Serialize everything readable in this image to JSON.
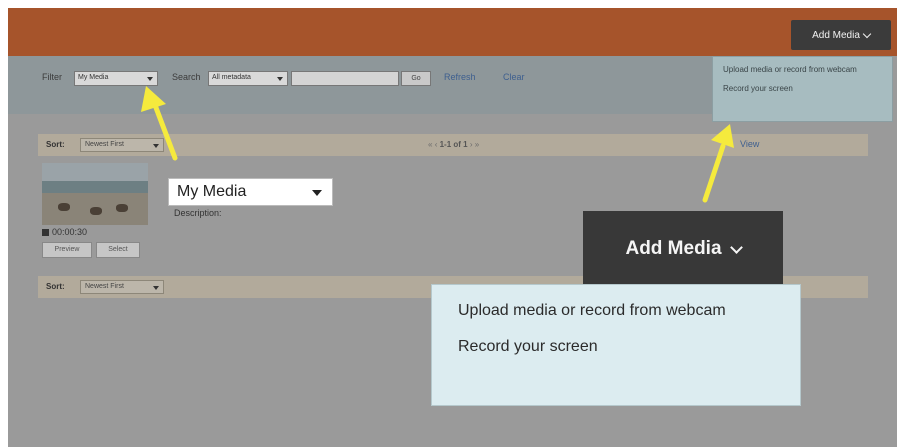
{
  "header": {
    "add_media_label": "Add Media"
  },
  "add_media_menu": {
    "items": [
      "Upload media or record from webcam",
      "Record your screen"
    ]
  },
  "filter_bar": {
    "filter_label": "Filter",
    "filter_value": "My Media",
    "search_label": "Search",
    "search_scope": "All metadata",
    "search_value": "",
    "go_label": "Go",
    "refresh_label": "Refresh",
    "clear_label": "Clear"
  },
  "sort_bar": {
    "sort_label": "Sort:",
    "sort_value": "Newest First",
    "pager_text": "1-1 of 1",
    "view_link": "View"
  },
  "media_item": {
    "duration": "00:00:30",
    "preview_label": "Preview",
    "select_label": "Select",
    "description_label": "Description:"
  },
  "callout": {
    "filter_value": "My Media",
    "add_media_label": "Add Media",
    "menu_items": [
      "Upload media or record from webcam",
      "Record your screen"
    ]
  },
  "colors": {
    "header_bg": "#a6542b",
    "button_dark": "#383838",
    "menu_bg": "#dcecf0",
    "arrow": "#f5ea3d",
    "link": "#3e5f8f"
  }
}
